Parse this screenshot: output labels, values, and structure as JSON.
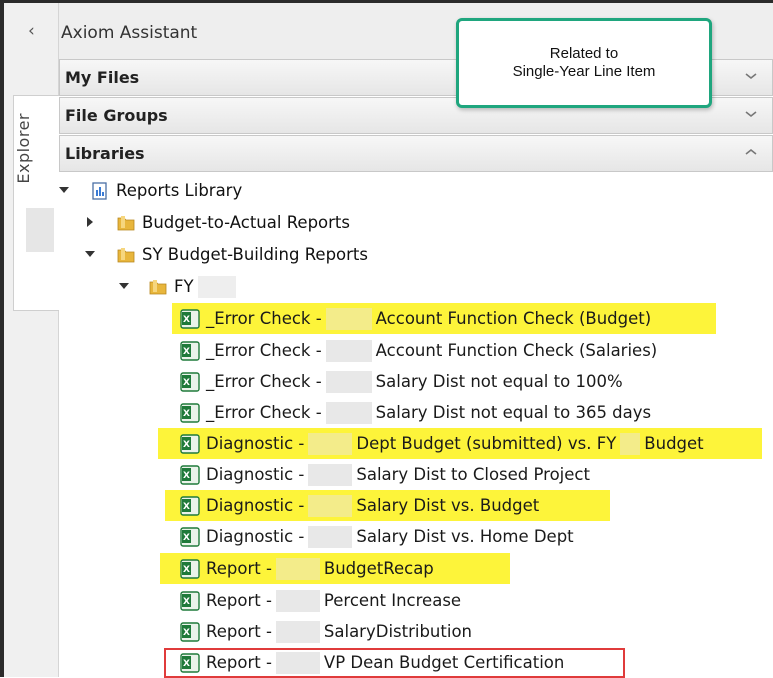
{
  "panel": {
    "title": "Axiom Assistant",
    "side_tab_label": "Explorer"
  },
  "sections": [
    {
      "label": "My Files",
      "state": "collapsed"
    },
    {
      "label": "File Groups",
      "state": "collapsed"
    },
    {
      "label": "Libraries",
      "state": "expanded"
    }
  ],
  "tree": {
    "root": "Reports Library",
    "folders": [
      {
        "label": "Budget-to-Actual Reports",
        "state": "collapsed"
      },
      {
        "label": "SY Budget-Building Reports",
        "state": "expanded"
      }
    ],
    "subfolder": {
      "label": "FY",
      "state": "expanded"
    },
    "files": [
      {
        "prefix": "_Error Check -",
        "name": "Account Function Check (Budget)",
        "highlighted": true
      },
      {
        "prefix": "_Error Check -",
        "name": "Account Function Check (Salaries)",
        "highlighted": false
      },
      {
        "prefix": "_Error Check -",
        "name": "Salary Dist not equal to 100%",
        "highlighted": false
      },
      {
        "prefix": "_Error Check -",
        "name": "Salary Dist not equal to 365 days",
        "highlighted": false
      },
      {
        "prefix": "Diagnostic -",
        "name": "Dept Budget (submitted) vs. FY",
        "suffix": "Budget",
        "highlighted": true
      },
      {
        "prefix": "Diagnostic -",
        "name": "Salary Dist to Closed Project",
        "highlighted": false
      },
      {
        "prefix": "Diagnostic -",
        "name": "Salary Dist vs. Budget",
        "highlighted": true
      },
      {
        "prefix": "Diagnostic -",
        "name": "Salary Dist vs. Home Dept",
        "highlighted": false
      },
      {
        "prefix": "Report -",
        "name": "BudgetRecap",
        "highlighted": true
      },
      {
        "prefix": "Report -",
        "name": "Percent Increase",
        "highlighted": false
      },
      {
        "prefix": "Report -",
        "name": "SalaryDistribution",
        "highlighted": false
      },
      {
        "prefix": "Report -",
        "name": "VP Dean Budget Certification",
        "highlighted": false,
        "boxed": true
      }
    ]
  },
  "callout": {
    "line1": "Related to",
    "line2": "Single-Year Line Item"
  },
  "colors": {
    "highlight": "#fdf43a",
    "callout_border": "#1fa67e",
    "box_outline": "#e03b3b",
    "excel_green": "#1f7a3a",
    "folder_yellow": "#e8b63c"
  },
  "icons": {
    "collapse": "chevron-left-icon",
    "section_collapsed": "chevron-down-icon",
    "section_expanded": "chevron-up-icon",
    "library": "report-library-icon",
    "folder": "folder-icon",
    "file": "excel-file-icon"
  }
}
